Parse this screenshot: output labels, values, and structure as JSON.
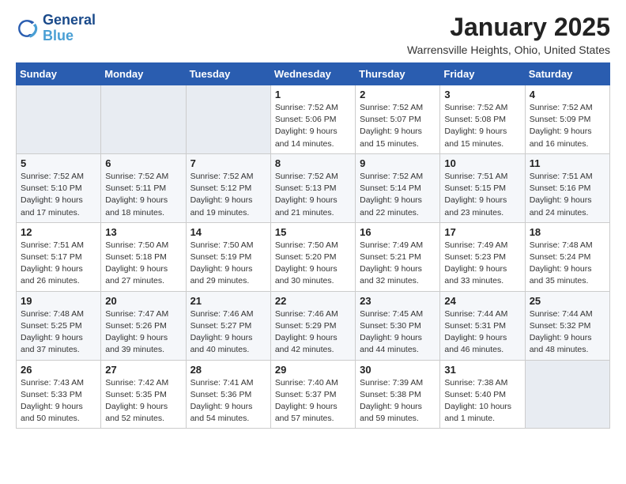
{
  "header": {
    "logo_line1": "General",
    "logo_line2": "Blue",
    "title": "January 2025",
    "subtitle": "Warrensville Heights, Ohio, United States"
  },
  "weekdays": [
    "Sunday",
    "Monday",
    "Tuesday",
    "Wednesday",
    "Thursday",
    "Friday",
    "Saturday"
  ],
  "weeks": [
    [
      {
        "day": "",
        "info": ""
      },
      {
        "day": "",
        "info": ""
      },
      {
        "day": "",
        "info": ""
      },
      {
        "day": "1",
        "info": "Sunrise: 7:52 AM\nSunset: 5:06 PM\nDaylight: 9 hours\nand 14 minutes."
      },
      {
        "day": "2",
        "info": "Sunrise: 7:52 AM\nSunset: 5:07 PM\nDaylight: 9 hours\nand 15 minutes."
      },
      {
        "day": "3",
        "info": "Sunrise: 7:52 AM\nSunset: 5:08 PM\nDaylight: 9 hours\nand 15 minutes."
      },
      {
        "day": "4",
        "info": "Sunrise: 7:52 AM\nSunset: 5:09 PM\nDaylight: 9 hours\nand 16 minutes."
      }
    ],
    [
      {
        "day": "5",
        "info": "Sunrise: 7:52 AM\nSunset: 5:10 PM\nDaylight: 9 hours\nand 17 minutes."
      },
      {
        "day": "6",
        "info": "Sunrise: 7:52 AM\nSunset: 5:11 PM\nDaylight: 9 hours\nand 18 minutes."
      },
      {
        "day": "7",
        "info": "Sunrise: 7:52 AM\nSunset: 5:12 PM\nDaylight: 9 hours\nand 19 minutes."
      },
      {
        "day": "8",
        "info": "Sunrise: 7:52 AM\nSunset: 5:13 PM\nDaylight: 9 hours\nand 21 minutes."
      },
      {
        "day": "9",
        "info": "Sunrise: 7:52 AM\nSunset: 5:14 PM\nDaylight: 9 hours\nand 22 minutes."
      },
      {
        "day": "10",
        "info": "Sunrise: 7:51 AM\nSunset: 5:15 PM\nDaylight: 9 hours\nand 23 minutes."
      },
      {
        "day": "11",
        "info": "Sunrise: 7:51 AM\nSunset: 5:16 PM\nDaylight: 9 hours\nand 24 minutes."
      }
    ],
    [
      {
        "day": "12",
        "info": "Sunrise: 7:51 AM\nSunset: 5:17 PM\nDaylight: 9 hours\nand 26 minutes."
      },
      {
        "day": "13",
        "info": "Sunrise: 7:50 AM\nSunset: 5:18 PM\nDaylight: 9 hours\nand 27 minutes."
      },
      {
        "day": "14",
        "info": "Sunrise: 7:50 AM\nSunset: 5:19 PM\nDaylight: 9 hours\nand 29 minutes."
      },
      {
        "day": "15",
        "info": "Sunrise: 7:50 AM\nSunset: 5:20 PM\nDaylight: 9 hours\nand 30 minutes."
      },
      {
        "day": "16",
        "info": "Sunrise: 7:49 AM\nSunset: 5:21 PM\nDaylight: 9 hours\nand 32 minutes."
      },
      {
        "day": "17",
        "info": "Sunrise: 7:49 AM\nSunset: 5:23 PM\nDaylight: 9 hours\nand 33 minutes."
      },
      {
        "day": "18",
        "info": "Sunrise: 7:48 AM\nSunset: 5:24 PM\nDaylight: 9 hours\nand 35 minutes."
      }
    ],
    [
      {
        "day": "19",
        "info": "Sunrise: 7:48 AM\nSunset: 5:25 PM\nDaylight: 9 hours\nand 37 minutes."
      },
      {
        "day": "20",
        "info": "Sunrise: 7:47 AM\nSunset: 5:26 PM\nDaylight: 9 hours\nand 39 minutes."
      },
      {
        "day": "21",
        "info": "Sunrise: 7:46 AM\nSunset: 5:27 PM\nDaylight: 9 hours\nand 40 minutes."
      },
      {
        "day": "22",
        "info": "Sunrise: 7:46 AM\nSunset: 5:29 PM\nDaylight: 9 hours\nand 42 minutes."
      },
      {
        "day": "23",
        "info": "Sunrise: 7:45 AM\nSunset: 5:30 PM\nDaylight: 9 hours\nand 44 minutes."
      },
      {
        "day": "24",
        "info": "Sunrise: 7:44 AM\nSunset: 5:31 PM\nDaylight: 9 hours\nand 46 minutes."
      },
      {
        "day": "25",
        "info": "Sunrise: 7:44 AM\nSunset: 5:32 PM\nDaylight: 9 hours\nand 48 minutes."
      }
    ],
    [
      {
        "day": "26",
        "info": "Sunrise: 7:43 AM\nSunset: 5:33 PM\nDaylight: 9 hours\nand 50 minutes."
      },
      {
        "day": "27",
        "info": "Sunrise: 7:42 AM\nSunset: 5:35 PM\nDaylight: 9 hours\nand 52 minutes."
      },
      {
        "day": "28",
        "info": "Sunrise: 7:41 AM\nSunset: 5:36 PM\nDaylight: 9 hours\nand 54 minutes."
      },
      {
        "day": "29",
        "info": "Sunrise: 7:40 AM\nSunset: 5:37 PM\nDaylight: 9 hours\nand 57 minutes."
      },
      {
        "day": "30",
        "info": "Sunrise: 7:39 AM\nSunset: 5:38 PM\nDaylight: 9 hours\nand 59 minutes."
      },
      {
        "day": "31",
        "info": "Sunrise: 7:38 AM\nSunset: 5:40 PM\nDaylight: 10 hours\nand 1 minute."
      },
      {
        "day": "",
        "info": ""
      }
    ]
  ]
}
